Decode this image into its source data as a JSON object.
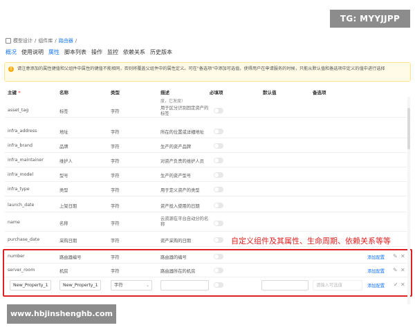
{
  "watermarks": {
    "top": "TG: MYYJJPP",
    "bottom": "www.hbjinshenghb.com"
  },
  "breadcrumb": {
    "root": "模型设计",
    "sep": "/",
    "lib": "组件库",
    "current": "路由器"
  },
  "tabs": [
    {
      "label": "概况",
      "active": true
    },
    {
      "label": "使用说明",
      "active": false
    },
    {
      "label": "属性",
      "active": true
    },
    {
      "label": "脚本列表",
      "active": false
    },
    {
      "label": "操作",
      "active": false
    },
    {
      "label": "监控",
      "active": false
    },
    {
      "label": "依赖关系",
      "active": false
    },
    {
      "label": "历史版本",
      "active": false
    }
  ],
  "alert": {
    "text": "请注意添加的属性键值和父组件中属性的键值不能相同，否则将覆盖父组件中的属性定义。可在\"备选项\"中添加可选值，使得用户在申请服务的时候，只能从默认值和备选项中定义的值中进行选择"
  },
  "columns": {
    "key": "主键",
    "required_mark": "*",
    "name": "名称",
    "type": "类型",
    "desc": "描述",
    "required": "必填项",
    "default": "默认值",
    "options": "备选项"
  },
  "partial_desc": "度，它发度）",
  "rows": [
    {
      "key": "asset_tag",
      "name": "标签",
      "type": "字符",
      "desc": "用于区分识别固定资产的标签"
    },
    {
      "key": "infra_address",
      "name": "地址",
      "type": "字符",
      "desc": "所在的位置或详细地址"
    },
    {
      "key": "infra_brand",
      "name": "品牌",
      "type": "字符",
      "desc": "生产的资产品牌"
    },
    {
      "key": "infra_maintainer",
      "name": "维护人",
      "type": "字符",
      "desc": "对资产负责的维护人员"
    },
    {
      "key": "infra_model",
      "name": "型号",
      "type": "字符",
      "desc": "生产的资产型号"
    },
    {
      "key": "infra_type",
      "name": "类型",
      "type": "字符",
      "desc": "用于定义资产的类型"
    },
    {
      "key": "launch_date",
      "name": "上架日期",
      "type": "字符",
      "desc": "资产投入使用的日期"
    },
    {
      "key": "name",
      "name": "名称",
      "type": "字符",
      "desc": "云资源在平台自动分的名称"
    },
    {
      "key": "purchase_date",
      "name": "采购日期",
      "type": "字符",
      "desc": "资产采购的日期"
    }
  ],
  "custom_rows": [
    {
      "key": "number",
      "name": "路由器编号",
      "type": "字符",
      "desc": "路由器的编号",
      "action": "添加配置"
    },
    {
      "key": "server_room",
      "name": "机房",
      "type": "字符",
      "desc": "路由器所在的机房",
      "action": "添加配置"
    }
  ],
  "edit_row": {
    "key_value": "New_Property_1",
    "name_value": "New_Property_1",
    "type_value": "字符",
    "options_placeholder": "请输入可选值",
    "action": "添加配置"
  },
  "annotation": "自定义组件及其属性、生命周期、依赖关系等等",
  "colors": {
    "accent": "#1677ff",
    "highlight": "#e02020",
    "alert_bg": "#fffbe6"
  }
}
